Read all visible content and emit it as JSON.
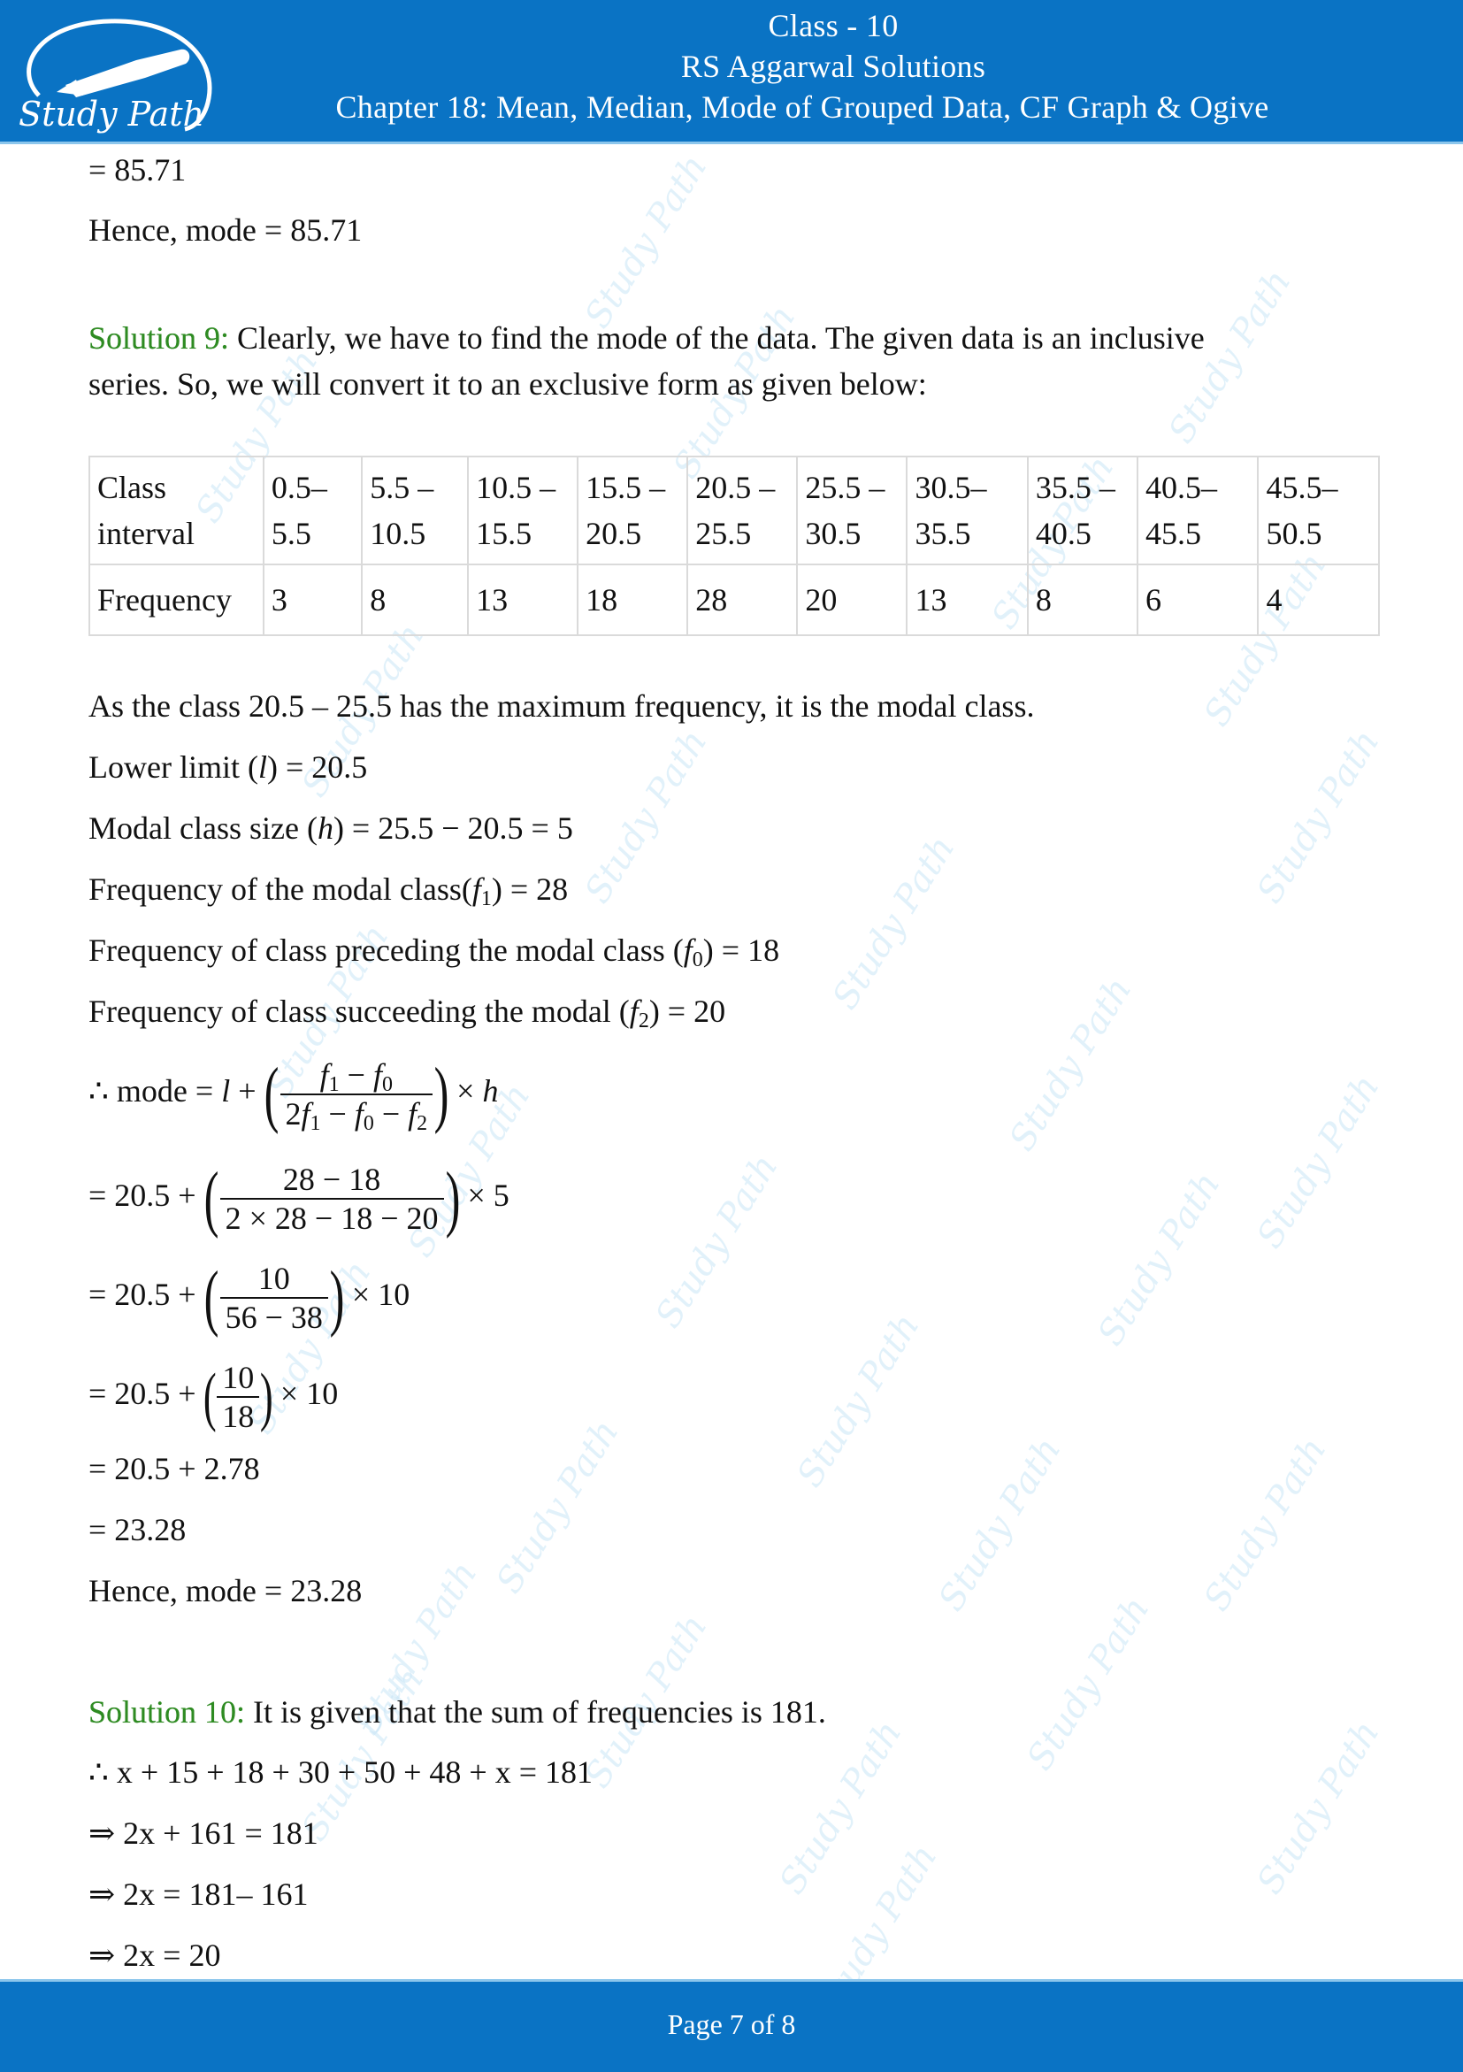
{
  "header": {
    "logo_text": "Study Path",
    "line1": "Class - 10",
    "line2": "RS Aggarwal Solutions",
    "line3": "Chapter 18: Mean, Median, Mode of Grouped Data, CF Graph & Ogive"
  },
  "prev": {
    "line1": "= 85.71",
    "line2": "Hence, mode = 85.71"
  },
  "solution9": {
    "label": "Solution 9:",
    "intro1": " Clearly, we have to find the mode of the data. The given data is an inclusive",
    "intro2": "series. So, we will convert it to an exclusive form as given below:",
    "table": {
      "row_headers": [
        "Class interval",
        "Frequency"
      ],
      "class_intervals": [
        [
          "0.5–",
          "5.5"
        ],
        [
          "5.5 –",
          "10.5"
        ],
        [
          "10.5 –",
          "15.5"
        ],
        [
          "15.5 –",
          "20.5"
        ],
        [
          "20.5 –",
          "25.5"
        ],
        [
          "25.5 –",
          "30.5"
        ],
        [
          "30.5–",
          "35.5"
        ],
        [
          "35.5 –",
          "40.5"
        ],
        [
          "40.5–",
          "45.5"
        ],
        [
          "45.5–",
          "50.5"
        ]
      ],
      "frequencies": [
        "3",
        "8",
        "13",
        "18",
        "28",
        "20",
        "13",
        "8",
        "6",
        "4"
      ]
    },
    "modal_text": "As the class 20.5 – 25.5 has the maximum frequency, it is the modal class.",
    "lower_limit": {
      "pre": "Lower limit (",
      "var": "l",
      "post": ") = 20.5"
    },
    "class_size": {
      "pre": "Modal class size (",
      "var": "h",
      "post": ") = 25.5 − 20.5 = 5"
    },
    "f1": {
      "pre": "Frequency of the modal class(",
      "var": "f",
      "sub": "1",
      "post": ") = 28"
    },
    "f0": {
      "pre": "Frequency of class preceding the modal class (",
      "var": "f",
      "sub": "0",
      "post": ") = 18"
    },
    "f2": {
      "pre": "Frequency of class succeeding the modal (",
      "var": "f",
      "sub": "2",
      "post": ") = 20"
    },
    "formula_prefix": "∴ mode = ",
    "step1": {
      "pre": "= 20.5 + ",
      "num": "28 − 18",
      "den": "2 × 28 − 18 − 20",
      "post": " × 5"
    },
    "step2": {
      "pre": "= 20.5 + ",
      "num": "10",
      "den": "56 − 38",
      "post": " × 10"
    },
    "step3": {
      "pre": "= 20.5 + ",
      "num": "10",
      "den": "18",
      "post": " × 10"
    },
    "step4": "= 20.5 + 2.78",
    "step5": "= 23.28",
    "result": "Hence, mode = 23.28"
  },
  "solution10": {
    "label": "Solution 10:",
    "intro": " It is given that the sum of frequencies is 181.",
    "eq1": "∴ x + 15 + 18 + 30 + 50 + 48 + x = 181",
    "eq2": "⇒ 2x + 161 = 181",
    "eq3": "⇒ 2x = 181– 161",
    "eq4": "⇒ 2x = 20"
  },
  "footer": {
    "page_text": "Page 7 of 8"
  },
  "watermark_text": "Study Path"
}
